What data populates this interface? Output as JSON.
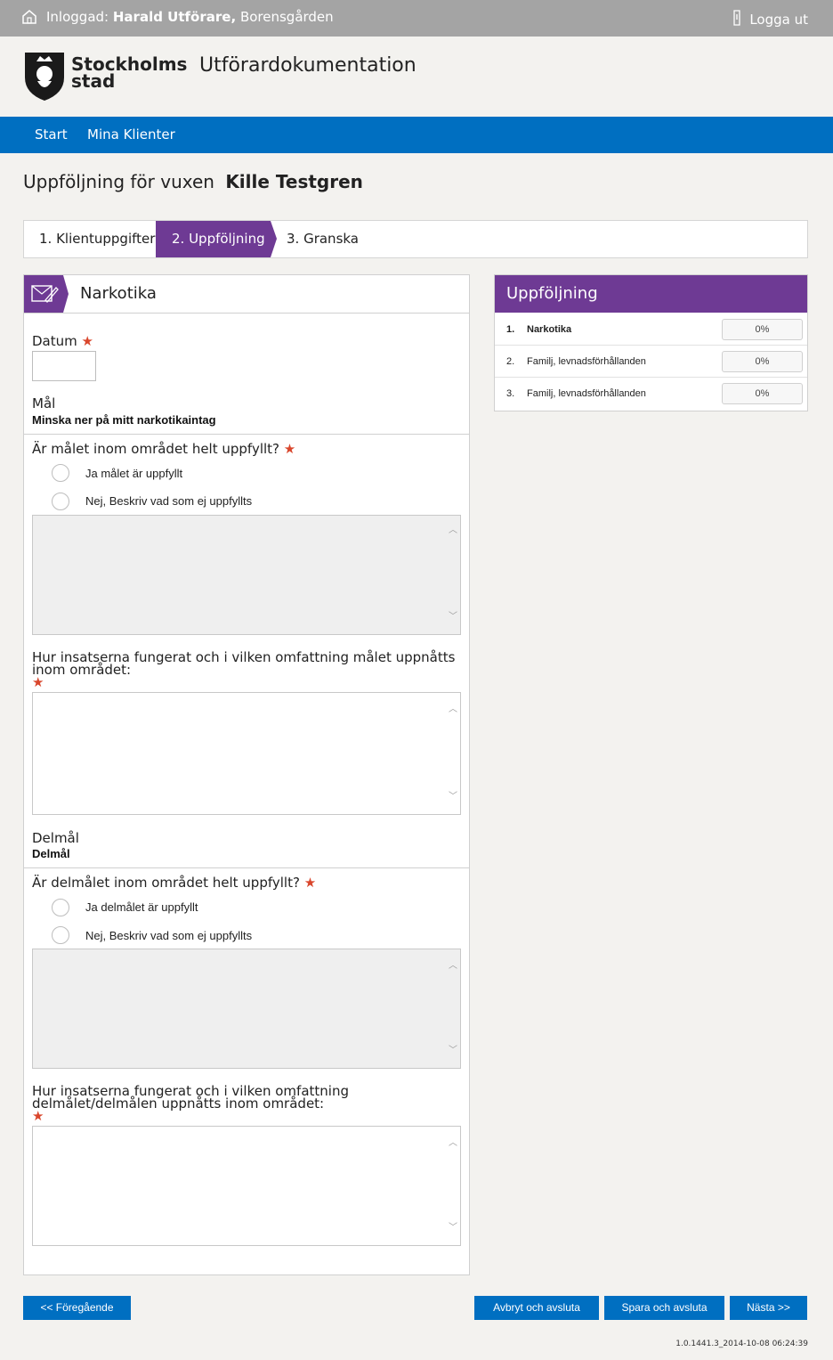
{
  "topbar": {
    "login_prefix": "Inloggad:",
    "user_name": "Harald Utförare,",
    "unit": "Borensgården",
    "logout_label": "Logga ut"
  },
  "header": {
    "logo_line1": "Stockholms",
    "logo_line2": "stad",
    "app_title": "Utförardokumentation"
  },
  "nav": {
    "items": [
      {
        "label": "Start"
      },
      {
        "label": "Mina Klienter"
      }
    ]
  },
  "page": {
    "heading": "Uppföljning för vuxen",
    "client_name": "Kille Testgren"
  },
  "steps": [
    {
      "label": "1. Klientuppgifter",
      "active": false
    },
    {
      "label": "2. Uppföljning",
      "active": true
    },
    {
      "label": "3. Granska",
      "active": false
    }
  ],
  "form": {
    "section_title": "Narkotika",
    "date_label": "Datum",
    "date_value": "",
    "goal_label": "Mål",
    "goal_value": "Minska ner på mitt narkotikaintag",
    "q_goal_fulfilled": "Är målet inom området helt uppfyllt?",
    "goal_radio_yes": "Ja målet är uppfyllt",
    "goal_radio_no": "Nej, Beskriv vad som ej uppfyllts",
    "q_goal_how": "Hur insatserna fungerat och i vilken omfattning målet uppnåtts inom området:",
    "subgoal_label": "Delmål",
    "subgoal_value": "Delmål",
    "q_subgoal_fulfilled": "Är delmålet inom området helt uppfyllt?",
    "subgoal_radio_yes": "Ja delmålet är uppfyllt",
    "subgoal_radio_no": "Nej, Beskriv vad som ej uppfyllts",
    "q_subgoal_how": "Hur insatserna fungerat och i vilken omfattning delmålet/delmålen uppnåtts inom området:",
    "required_mark": "★"
  },
  "sidebar": {
    "title": "Uppföljning",
    "items": [
      {
        "num": "1.",
        "name": "Narkotika",
        "progress": "0%",
        "active": true
      },
      {
        "num": "2.",
        "name": "Familj, levnadsförhållanden",
        "progress": "0%",
        "active": false
      },
      {
        "num": "3.",
        "name": "Familj, levnadsförhållanden",
        "progress": "0%",
        "active": false
      }
    ]
  },
  "buttons": {
    "previous": "<< Föregående",
    "cancel": "Avbryt och avsluta",
    "save": "Spara och avsluta",
    "next": "Nästa >>"
  },
  "footer": {
    "version": "1.0.1441.3_2014-10-08 06:24:39"
  },
  "colors": {
    "accent_purple": "#6e3a94",
    "nav_blue": "#006fc1",
    "topbar_gray": "#a4a4a4",
    "required_red": "#d9462c"
  }
}
